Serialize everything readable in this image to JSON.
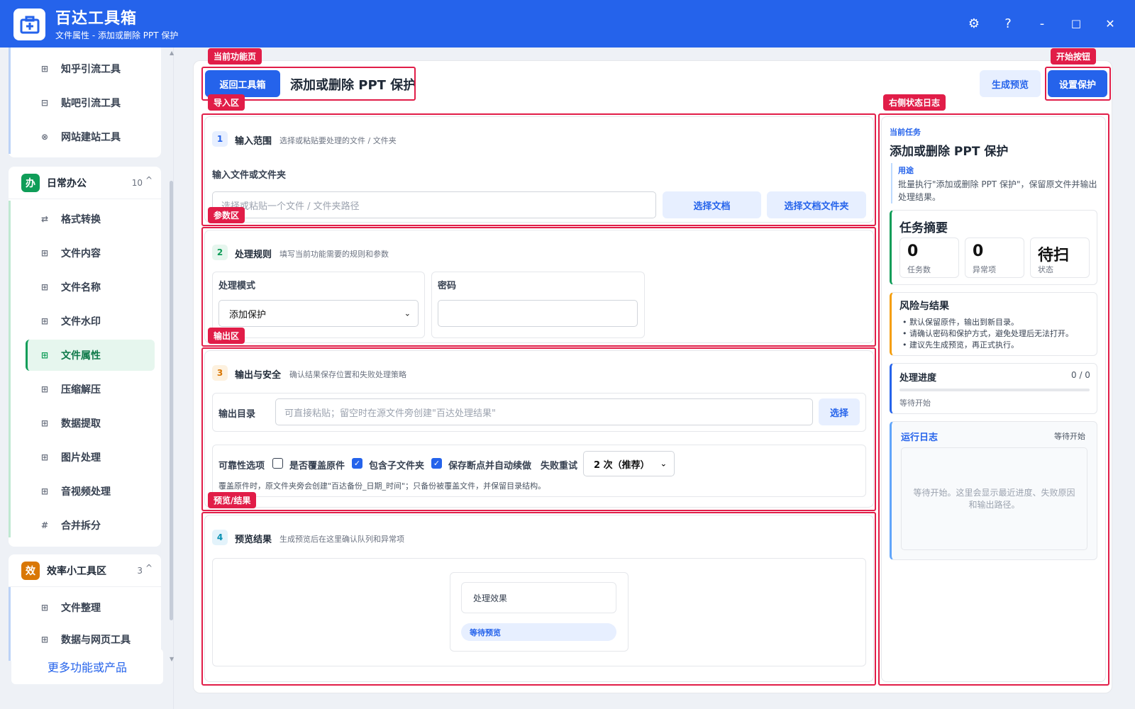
{
  "app": {
    "title": "百达工具箱",
    "subtitle": "文件属性 - 添加或删除 PPT 保护",
    "controls": {
      "settings": "⚙",
      "help": "?",
      "minimize": "-",
      "maximize": "□",
      "close": "✕"
    }
  },
  "sidebar": {
    "top_items": [
      {
        "label": "知乎引流工具",
        "icon": "⊞"
      },
      {
        "label": "贴吧引流工具",
        "icon": "⊟"
      },
      {
        "label": "网站建站工具",
        "icon": "⊗"
      }
    ],
    "groups": [
      {
        "badge": "办",
        "name": "日常办公",
        "count": "10",
        "caret": "^",
        "color": "#0f9d58"
      },
      {
        "badge": "效",
        "name": "效率小工具区",
        "count": "3",
        "caret": "^",
        "color": "#d97706"
      }
    ],
    "office_items": [
      {
        "label": "格式转换",
        "icon": "⇄"
      },
      {
        "label": "文件内容",
        "icon": "⊞"
      },
      {
        "label": "文件名称",
        "icon": "⊞"
      },
      {
        "label": "文件水印",
        "icon": "⊞"
      },
      {
        "label": "文件属性",
        "icon": "⊞"
      },
      {
        "label": "压缩解压",
        "icon": "⊞"
      },
      {
        "label": "数据提取",
        "icon": "⊞"
      },
      {
        "label": "图片处理",
        "icon": "⊞"
      },
      {
        "label": "音视频处理",
        "icon": "⊞"
      },
      {
        "label": "合并拆分",
        "icon": "#"
      }
    ],
    "efficiency_items": [
      {
        "label": "文件整理",
        "icon": "⊞"
      },
      {
        "label": "数据与网页工具",
        "icon": "⊞"
      }
    ],
    "more": "更多功能或产品"
  },
  "header": {
    "back": "返回工具箱",
    "title": "添加或删除 PPT 保护",
    "preview": "生成预览",
    "start": "设置保护"
  },
  "annotations": {
    "current_page": "当前功能页",
    "start_button": "开始按钮",
    "import_area": "导入区",
    "right_log": "右侧状态日志",
    "params_area": "参数区",
    "output_area": "输出区",
    "preview_area": "预览/结果"
  },
  "sections": {
    "input": {
      "step": "1",
      "title": "输入范围",
      "desc": "选择或粘贴要处理的文件 / 文件夹",
      "label": "输入文件或文件夹",
      "placeholder": "选择或粘贴一个文件 / 文件夹路径",
      "btn_doc": "选择文档",
      "btn_folder": "选择文档文件夹"
    },
    "rules": {
      "step": "2",
      "title": "处理规则",
      "desc": "填写当前功能需要的规则和参数",
      "mode_label": "处理模式",
      "mode_value": "添加保护",
      "pwd_label": "密码"
    },
    "output": {
      "step": "3",
      "title": "输出与安全",
      "desc": "确认结果保存位置和失败处理策略",
      "dir_label": "输出目录",
      "dir_placeholder": "可直接粘贴；留空时在源文件旁创建\"百达处理结果\"",
      "dir_btn": "选择",
      "reliability_label": "可靠性选项",
      "overwrite_label": "是否覆盖原件",
      "subfolder_label": "包含子文件夹",
      "resume_label": "保存断点并自动续做",
      "retry_label": "失败重试",
      "retry_value": "2 次（推荐）",
      "note": "覆盖原件时，原文件夹旁会创建\"百达备份_日期_时间\"；只备份被覆盖文件，并保留目录结构。"
    },
    "preview": {
      "step": "4",
      "title": "预览结果",
      "desc": "生成预览后在这里确认队列和异常项",
      "effect": "处理效果",
      "status": "等待预览"
    }
  },
  "right_panel": {
    "current_task_label": "当前任务",
    "task_title": "添加或删除 PPT 保护",
    "purpose_label": "用途",
    "purpose_text": "批量执行\"添加或删除 PPT 保护\"，保留原文件并输出处理结果。",
    "summary_title": "任务摘要",
    "stats": [
      {
        "value": "0",
        "label": "任务数"
      },
      {
        "value": "0",
        "label": "异常项"
      },
      {
        "value": "待扫",
        "label": "状态"
      }
    ],
    "risk_title": "风险与结果",
    "risks": [
      "默认保留原件，输出到新目录。",
      "请确认密码和保护方式，避免处理后无法打开。",
      "建议先生成预览，再正式执行。"
    ],
    "progress_title": "处理进度",
    "progress_count": "0 / 0",
    "progress_value": 0,
    "progress_status": "等待开始",
    "log_title": "运行日志",
    "log_status": "等待开始",
    "log_placeholder": "等待开始。这里会显示最近进度、失败原因和输出路径。"
  }
}
